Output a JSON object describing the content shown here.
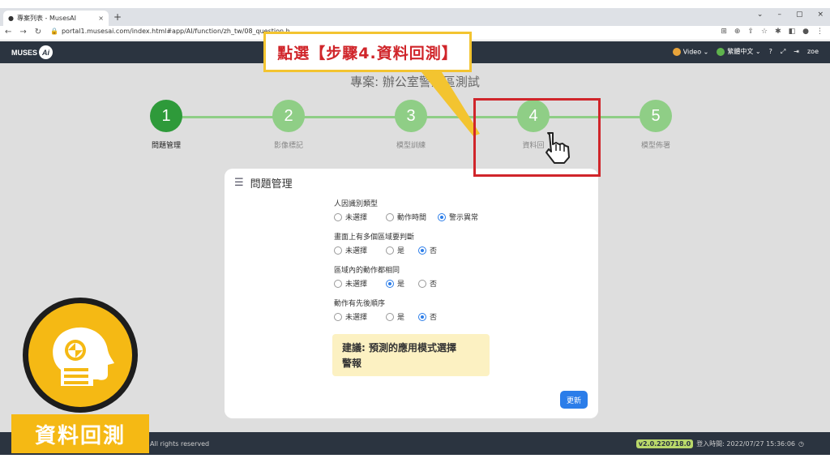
{
  "browser": {
    "tab_title": "專案列表 - MusesAI",
    "tab_close": "×",
    "new_tab": "+",
    "url": "portal1.musesai.com/index.html#app/AI/function/zh_tw/08_question.h",
    "window_controls": [
      "⌄",
      "–",
      "▢",
      "×"
    ]
  },
  "header": {
    "logo_text": "MUSES",
    "logo_badge": "Ai",
    "video_label": "Video",
    "language_label": "繁體中文",
    "user": "zoe"
  },
  "project_title": "專案: 辦公室警戒區測試",
  "steps": [
    {
      "num": "1",
      "label": "問題管理"
    },
    {
      "num": "2",
      "label": "影像標記"
    },
    {
      "num": "3",
      "label": "模型訓練"
    },
    {
      "num": "4",
      "label": "資料回"
    },
    {
      "num": "5",
      "label": "模型佈署"
    }
  ],
  "card": {
    "title": "問題管理",
    "questions": [
      {
        "label": "人因識別類型",
        "options": [
          "未選擇",
          "動作時間",
          "警示異常"
        ],
        "selected": 2
      },
      {
        "label": "畫面上有多個區域要判斷",
        "options": [
          "未選擇",
          "是",
          "否"
        ],
        "selected": 2
      },
      {
        "label": "區域內的動作都相同",
        "options": [
          "未選擇",
          "是",
          "否"
        ],
        "selected": 1
      },
      {
        "label": "動作有先後順序",
        "options": [
          "未選擇",
          "是",
          "否"
        ],
        "selected": 2
      }
    ],
    "suggestion_line1": "建議: 預測的應用模式選擇",
    "suggestion_line2": "警報",
    "update_button": "更新"
  },
  "footer": {
    "copyright": "All rights reserved",
    "version": "v2.0.220718.0",
    "login_time": "登入時間: 2022/07/27 15:36:06"
  },
  "callout_text": "點選【步驟4.資料回測】",
  "badge_label": "資料回測",
  "colors": {
    "accent": "#2e9a3a",
    "step_light": "#8fce86",
    "highlight": "#d0252a",
    "badge": "#f5b914"
  }
}
